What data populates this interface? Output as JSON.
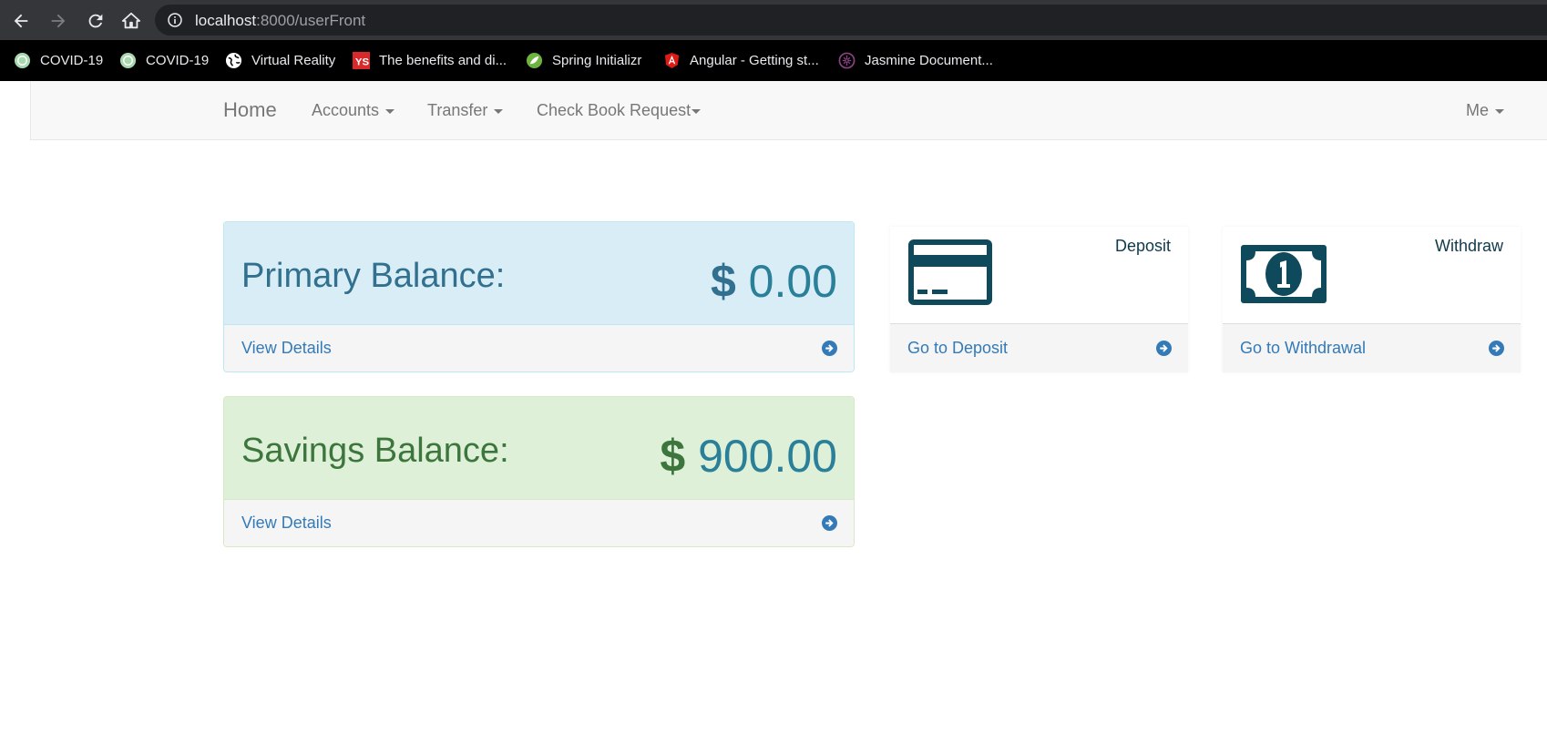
{
  "browser": {
    "url_host": "localhost",
    "url_rest": ":8000/userFront",
    "bookmarks": [
      {
        "label": "COVID-19",
        "icon": "covid-globe-icon"
      },
      {
        "label": "COVID-19",
        "icon": "covid-globe-icon"
      },
      {
        "label": "Virtual Reality",
        "icon": "globe-icon"
      },
      {
        "label": "The benefits and di...",
        "icon": "ys-logo-icon"
      },
      {
        "label": "Spring Initializr",
        "icon": "spring-leaf-icon"
      },
      {
        "label": "Angular - Getting st...",
        "icon": "angular-logo-icon"
      },
      {
        "label": "Jasmine Document...",
        "icon": "jasmine-logo-icon"
      }
    ]
  },
  "navbar": {
    "brand": "Home",
    "items": [
      "Accounts",
      "Transfer",
      "Check Book Request"
    ],
    "user_menu": "Me"
  },
  "primary": {
    "label": "Primary Balance:",
    "currency": "$",
    "amount": "0.00",
    "footer_link": "View Details"
  },
  "savings": {
    "label": "Savings Balance:",
    "currency": "$",
    "amount": "900.00",
    "footer_link": "View Details"
  },
  "deposit": {
    "title": "Deposit",
    "link": "Go to Deposit",
    "icon": "credit-card-icon"
  },
  "withdraw": {
    "title": "Withdraw",
    "link": "Go to Withdrawal",
    "icon": "money-bill-icon"
  },
  "colors": {
    "info_bg": "#d9edf7",
    "success_bg": "#dff0d8",
    "link": "#337ab7",
    "icon_dark": "#0f4a5c"
  }
}
